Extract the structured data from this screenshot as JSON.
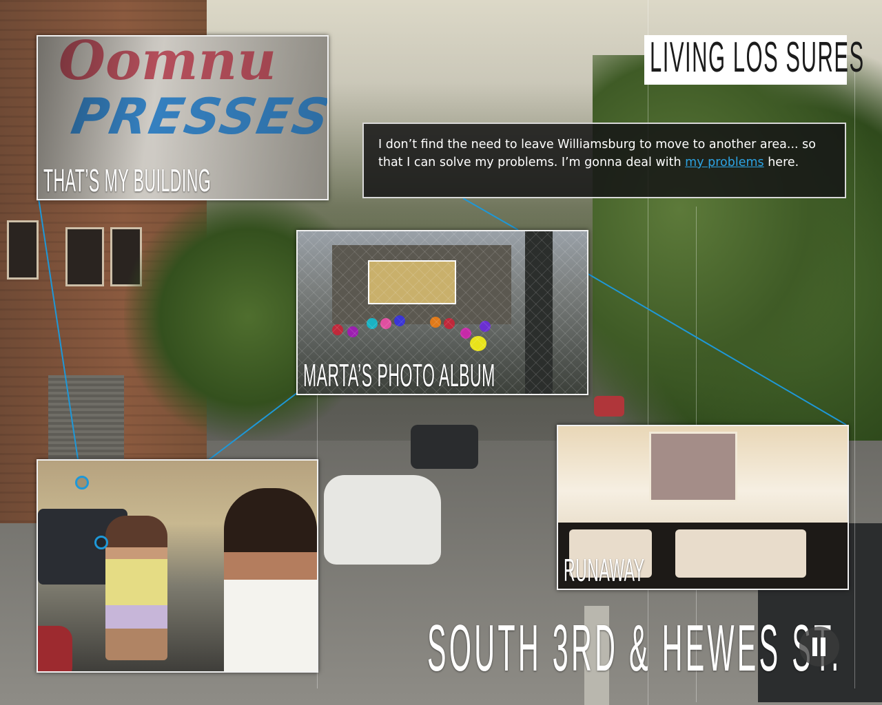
{
  "app": {
    "logo_text": "LIVING LOS SURES",
    "location_title": "SOUTH 3RD & HEWES ST.",
    "accent_color": "#1e98d8",
    "pause_icon": "pause-icon"
  },
  "quote": {
    "text_before": "I don’t find the need to leave Williamsburg to move to another area... so that I can solve my problems. I’m gonna deal with ",
    "link_text": "my problems",
    "text_after": " here."
  },
  "panels": {
    "building": {
      "label": "THAT’S MY BUILDING"
    },
    "album": {
      "label": "MARTA’S PHOTO ALBUM"
    },
    "runaway": {
      "label": "RUNAWAY"
    },
    "photo": {
      "label": ""
    }
  }
}
